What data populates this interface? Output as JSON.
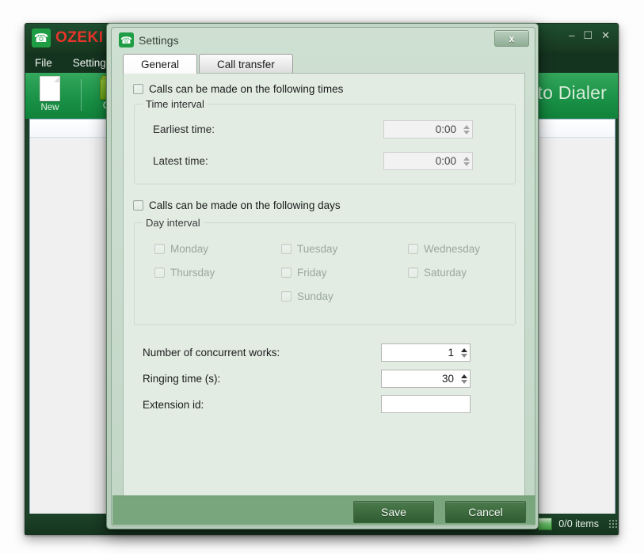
{
  "app": {
    "brand_word": "OZEKI",
    "logo_icon": "phone-handset-icon",
    "product_title": "Auto Dialer",
    "menu": [
      {
        "label": "File"
      },
      {
        "label": "Settings"
      }
    ],
    "ribbon": [
      {
        "label": "New",
        "icon": "new-document-icon"
      },
      {
        "label": "Open",
        "icon": "open-folder-icon"
      }
    ],
    "window_buttons": {
      "minimize": "–",
      "maximize": "☐",
      "close": "✕"
    },
    "status": {
      "items_text": "0/0 items",
      "chip_icon": "progress-chip-icon",
      "grip_icon": "resize-grip-icon"
    }
  },
  "dialog": {
    "title": "Settings",
    "icon": "phone-handset-icon",
    "close_label": "x",
    "tabs": [
      {
        "label": "General",
        "active": true
      },
      {
        "label": "Call transfer",
        "active": false
      }
    ],
    "general": {
      "times_checkbox": {
        "label": "Calls can be made on the following times",
        "checked": false
      },
      "time_interval": {
        "title": "Time interval",
        "fields": [
          {
            "label": "Earliest time:",
            "value": "0:00",
            "enabled": false
          },
          {
            "label": "Latest time:",
            "value": "0:00",
            "enabled": false
          }
        ]
      },
      "days_checkbox": {
        "label": "Calls can be made on the following days",
        "checked": false
      },
      "day_interval": {
        "title": "Day interval",
        "days": [
          {
            "label": "Monday",
            "checked": false
          },
          {
            "label": "Tuesday",
            "checked": false
          },
          {
            "label": "Wednesday",
            "checked": false
          },
          {
            "label": "Thursday",
            "checked": false
          },
          {
            "label": "Friday",
            "checked": false
          },
          {
            "label": "Saturday",
            "checked": false
          },
          {
            "label": "Sunday",
            "checked": false
          }
        ]
      },
      "settings_fields": [
        {
          "label": "Number of concurrent works:",
          "value": "1",
          "type": "spinner"
        },
        {
          "label": "Ringing time (s):",
          "value": "30",
          "type": "spinner"
        },
        {
          "label": "Extension id:",
          "value": "",
          "type": "textbox"
        }
      ]
    },
    "footer": {
      "save_label": "Save",
      "cancel_label": "Cancel"
    }
  },
  "colors": {
    "brand_red": "#e8342b",
    "brand_green": "#1f9d44",
    "ribbon_green": "#1a9247",
    "dialog_panel": "#e2ece3",
    "footer_green": "#7aa67e",
    "button_green": "#3d6b3e"
  }
}
